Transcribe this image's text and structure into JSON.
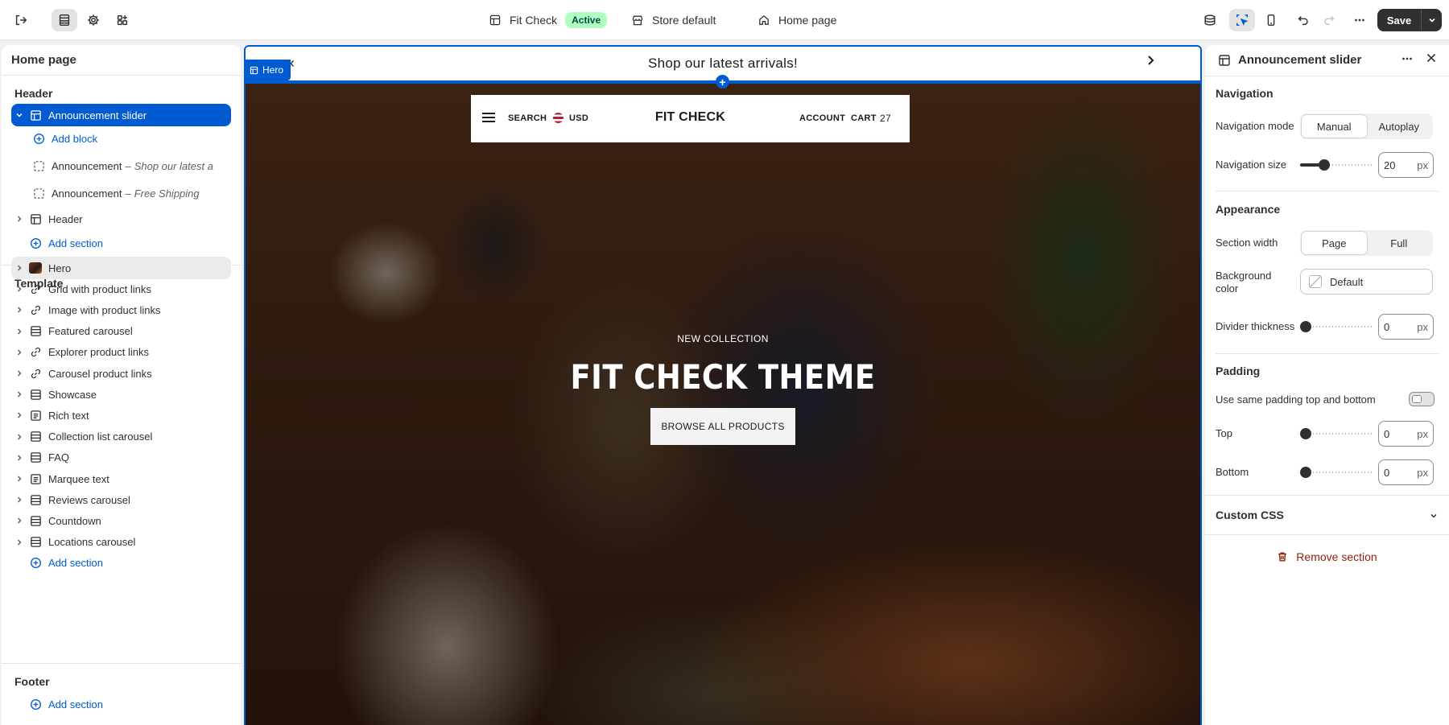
{
  "topbar": {
    "theme_name": "Fit Check",
    "theme_status": "Active",
    "store_context": "Store default",
    "page_selector": "Home page",
    "save_label": "Save",
    "more_icon": "more-horizontal-icon"
  },
  "left": {
    "title": "Home page",
    "header_group": "Header",
    "template_group": "Template",
    "footer_group": "Footer",
    "header_items": [
      {
        "label": "Announcement slider",
        "icon": "section-icon"
      },
      {
        "label": "Add block",
        "icon": "plus-circle-icon"
      },
      {
        "label": "Announcement",
        "sub": "Shop our latest a",
        "icon": "block-icon"
      },
      {
        "label": "Announcement",
        "sub": "Free Shipping",
        "icon": "block-icon"
      },
      {
        "label": "Header",
        "icon": "section-icon"
      },
      {
        "label": "Add section",
        "icon": "plus-circle-icon"
      }
    ],
    "template_items": [
      {
        "label": "Hero",
        "icon": "image-thumbnail"
      },
      {
        "label": "Grid with product links",
        "icon": "link-icon"
      },
      {
        "label": "Image with product links",
        "icon": "link-icon"
      },
      {
        "label": "Featured carousel",
        "icon": "section-icon"
      },
      {
        "label": "Explorer product links",
        "icon": "link-icon"
      },
      {
        "label": "Carousel product links",
        "icon": "link-icon"
      },
      {
        "label": "Showcase",
        "icon": "section-icon"
      },
      {
        "label": "Rich text",
        "icon": "text-icon"
      },
      {
        "label": "Collection list carousel",
        "icon": "section-icon"
      },
      {
        "label": "FAQ",
        "icon": "section-icon"
      },
      {
        "label": "Marquee text",
        "icon": "text-icon"
      },
      {
        "label": "Reviews carousel",
        "icon": "section-icon"
      },
      {
        "label": "Countdown",
        "icon": "section-icon"
      },
      {
        "label": "Locations carousel",
        "icon": "section-icon"
      },
      {
        "label": "Add section",
        "icon": "plus-circle-icon"
      }
    ],
    "footer_items": [
      {
        "label": "Add section",
        "icon": "plus-circle-icon"
      }
    ]
  },
  "preview": {
    "announcement": "Shop our latest arrivals!",
    "hero_tag": "Hero",
    "store_header": {
      "search": "SEARCH",
      "currency": "USD",
      "logo": "FIT CHECK",
      "account": "ACCOUNT",
      "cart": "CART",
      "cart_count": "27"
    },
    "hero": {
      "eyebrow": "NEW COLLECTION",
      "title": "FIT CHECK THEME",
      "cta": "BROWSE ALL PRODUCTS"
    }
  },
  "right": {
    "title": "Announcement slider",
    "navigation": {
      "heading": "Navigation",
      "mode_label": "Navigation mode",
      "mode_options": [
        "Manual",
        "Autoplay"
      ],
      "mode_selected": "Manual",
      "size_label": "Navigation size",
      "size_value": "20",
      "size_fraction": 0.3,
      "unit": "px"
    },
    "appearance": {
      "heading": "Appearance",
      "width_label": "Section width",
      "width_options": [
        "Page",
        "Full"
      ],
      "width_selected": "Page",
      "bg_label": "Background color",
      "bg_value": "Default",
      "divider_label": "Divider thickness",
      "divider_value": "0",
      "unit": "px"
    },
    "padding": {
      "heading": "Padding",
      "same_label": "Use same padding top and bottom",
      "same_on": false,
      "top_label": "Top",
      "top_value": "0",
      "bottom_label": "Bottom",
      "bottom_value": "0",
      "unit": "px"
    },
    "custom_css": "Custom CSS",
    "remove": "Remove section"
  },
  "colors": {
    "accent": "#005bd3",
    "save_bg": "#303030",
    "active_badge_bg": "#affebf",
    "danger": "#8e1f0b"
  }
}
